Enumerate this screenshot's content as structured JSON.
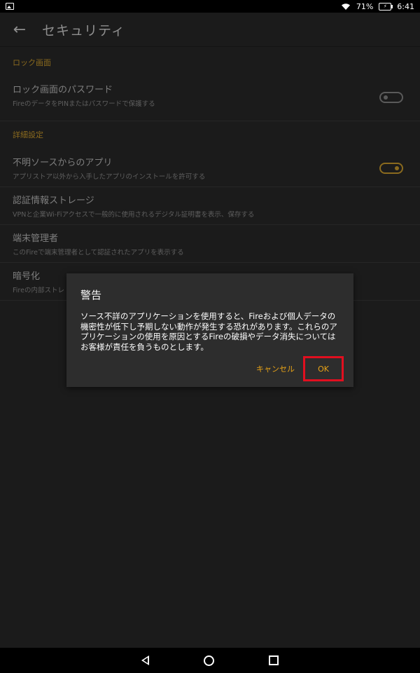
{
  "status_bar": {
    "battery_percent": "71%",
    "time": "6:41"
  },
  "header": {
    "title": "セキュリティ",
    "back_icon": "arrow-left-icon"
  },
  "sections": [
    {
      "header": "ロック画面",
      "items": [
        {
          "title": "ロック画面のパスワード",
          "subtitle": "FireのデータをPINまたはパスワードで保護する",
          "toggle": "off"
        }
      ]
    },
    {
      "header": "詳細設定",
      "items": [
        {
          "title": "不明ソースからのアプリ",
          "subtitle": "アプリストア以外から入手したアプリのインストールを許可する",
          "toggle": "on"
        },
        {
          "title": "認証情報ストレージ",
          "subtitle": "VPNと企業Wi-Fiアクセスで一般的に使用されるデジタル証明書を表示、保存する"
        },
        {
          "title": "端末管理者",
          "subtitle": "このFireで端末管理者として認証されたアプリを表示する"
        },
        {
          "title": "暗号化",
          "subtitle": "Fireの内部ストレ"
        }
      ]
    }
  ],
  "dialog": {
    "title": "警告",
    "body": "ソース不詳のアプリケーションを使用すると、Fireおよび個人データの機密性が低下し予期しない動作が発生する恐れがあります。これらのアプリケーションの使用を原因とするFireの破損やデータ消失についてはお客様が責任を負うものとします。",
    "cancel_label": "キャンセル",
    "ok_label": "OK"
  },
  "colors": {
    "accent": "#e8a317",
    "highlight_box": "#e10f1f",
    "background": "#1b1b1b",
    "dialog_bg": "#2d2d2d"
  }
}
